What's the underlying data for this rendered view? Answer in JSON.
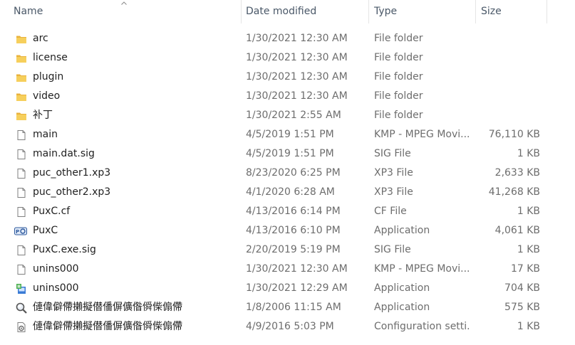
{
  "columns": {
    "name": "Name",
    "date": "Date modified",
    "type": "Type",
    "size": "Size"
  },
  "files": [
    {
      "name": "arc",
      "date": "1/30/2021 12:30 AM",
      "type": "File folder",
      "size": "",
      "icon": "folder-icon"
    },
    {
      "name": "license",
      "date": "1/30/2021 12:30 AM",
      "type": "File folder",
      "size": "",
      "icon": "folder-icon"
    },
    {
      "name": "plugin",
      "date": "1/30/2021 12:30 AM",
      "type": "File folder",
      "size": "",
      "icon": "folder-icon"
    },
    {
      "name": "video",
      "date": "1/30/2021 12:30 AM",
      "type": "File folder",
      "size": "",
      "icon": "folder-icon"
    },
    {
      "name": "补丁",
      "date": "1/30/2021 2:55 AM",
      "type": "File folder",
      "size": "",
      "icon": "folder-icon"
    },
    {
      "name": "main",
      "date": "4/5/2019 1:51 PM",
      "type": "KMP - MPEG Movi...",
      "size": "76,110 KB",
      "icon": "file-icon"
    },
    {
      "name": "main.dat.sig",
      "date": "4/5/2019 1:51 PM",
      "type": "SIG File",
      "size": "1 KB",
      "icon": "file-icon"
    },
    {
      "name": "puc_other1.xp3",
      "date": "8/23/2020 6:25 PM",
      "type": "XP3 File",
      "size": "2,633 KB",
      "icon": "file-icon"
    },
    {
      "name": "puc_other2.xp3",
      "date": "4/1/2020 6:28 AM",
      "type": "XP3 File",
      "size": "41,268 KB",
      "icon": "file-icon"
    },
    {
      "name": "PuxC.cf",
      "date": "4/13/2016 6:14 PM",
      "type": "CF File",
      "size": "1 KB",
      "icon": "file-icon"
    },
    {
      "name": "PuxC",
      "date": "4/13/2016 6:10 PM",
      "type": "Application",
      "size": "4,061 KB",
      "icon": "app-puxc-icon"
    },
    {
      "name": "PuxC.exe.sig",
      "date": "2/20/2019 5:19 PM",
      "type": "SIG File",
      "size": "1 KB",
      "icon": "file-icon"
    },
    {
      "name": "unins000",
      "date": "1/30/2021 12:30 AM",
      "type": "KMP - MPEG Movi...",
      "size": "17 KB",
      "icon": "file-icon"
    },
    {
      "name": "unins000",
      "date": "1/30/2021 12:29 AM",
      "type": "Application",
      "size": "704 KB",
      "icon": "installer-icon"
    },
    {
      "name": "僆偉僻僀攋擬僣僠偋儣偺僢偨傓僀",
      "date": "1/8/2006 11:15 AM",
      "type": "Application",
      "size": "575 KB",
      "icon": "magnifier-app-icon"
    },
    {
      "name": "僆偉僻僀攋擬僣僠偋儣偺僢偨傓僀",
      "date": "4/9/2016 5:03 PM",
      "type": "Configuration setti...",
      "size": "1 KB",
      "icon": "config-icon"
    }
  ],
  "colors": {
    "folder": "#f4c54a",
    "header_text": "#4a5868",
    "detail_text": "#6d6d6d"
  }
}
